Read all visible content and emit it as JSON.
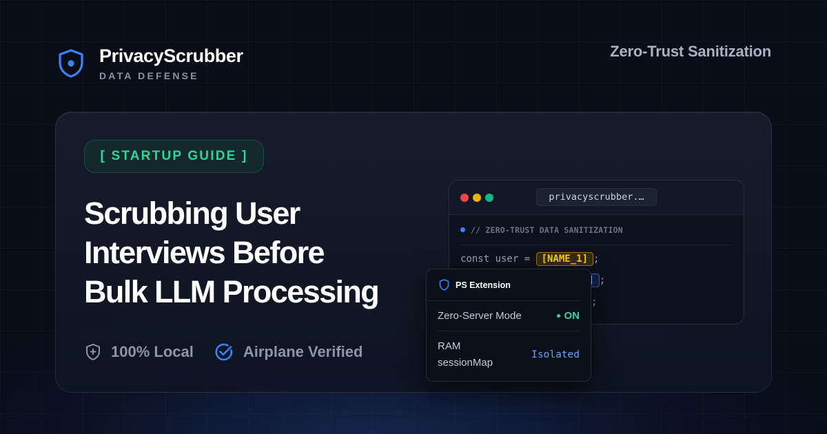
{
  "brand": {
    "name": "PrivacyScrubber",
    "tagline": "DATA DEFENSE",
    "logo_icon": "shield-icon"
  },
  "header": {
    "right_label": "Zero-Trust Sanitization"
  },
  "hero": {
    "badge": "[ STARTUP GUIDE ]",
    "headline_lines": [
      "Scrubbing User",
      "Interviews Before",
      "Bulk LLM Processing"
    ]
  },
  "features": [
    {
      "icon": "shield-check-icon",
      "label": "100% Local"
    },
    {
      "icon": "circle-check-icon",
      "label": "Airplane Verified"
    }
  ],
  "code_window": {
    "url": "privacyscrubber.…",
    "comment": "// ZERO-TRUST DATA SANITIZATION",
    "line1_prefix": "const user = ",
    "line1_token": "[NAME_1]",
    "line1_suffix": ";",
    "line2_token_visible": "1]",
    "line2_suffix": ";",
    "line3_token_visible": "",
    "line3_suffix": ";"
  },
  "extension_popup": {
    "title": "PS Extension",
    "rows": [
      {
        "label": "Zero-Server Mode",
        "value": "ON"
      },
      {
        "label_line1": "RAM",
        "label_line2": "sessionMap",
        "value": "Isolated"
      }
    ]
  },
  "colors": {
    "background": "#090d18",
    "accent_green": "#34d399",
    "accent_blue": "#3b82f6",
    "token_yellow": "#facc15",
    "token_pink": "#f9a8d4"
  }
}
